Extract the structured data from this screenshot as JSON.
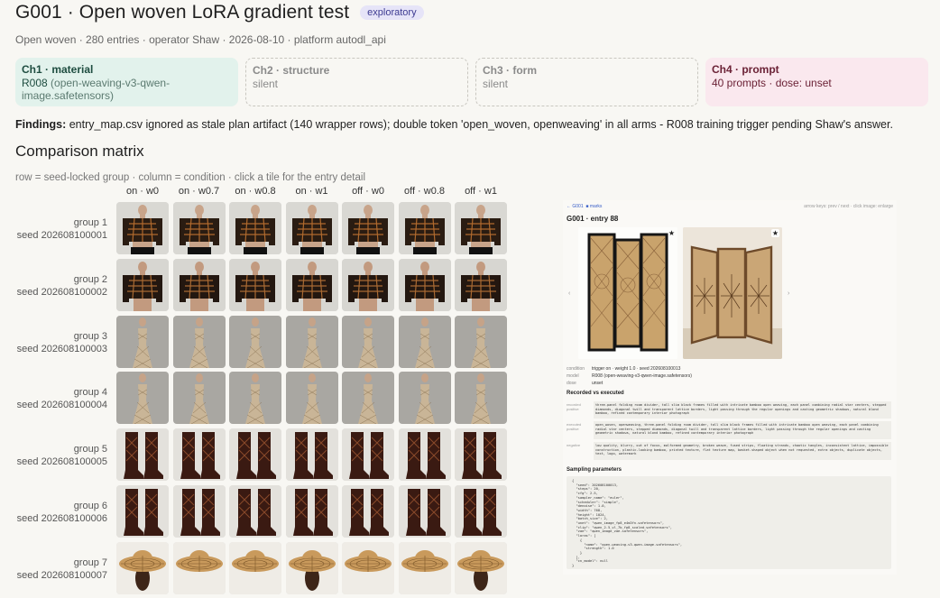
{
  "header": {
    "title": "G001 · Open woven LoRA gradient test",
    "badge": "exploratory",
    "meta": "Open woven · 280 entries · operator Shaw · 2026-08-10 · platform autodl_api"
  },
  "channels": [
    {
      "title": "Ch1 · material",
      "line1": "R008",
      "line1_rest": " (open-weaving-v3-qwen-",
      "line2": "image.safetensors)",
      "state": "active"
    },
    {
      "title": "Ch2 · structure",
      "line1": "silent",
      "state": "silent"
    },
    {
      "title": "Ch3 · form",
      "line1": "silent",
      "state": "silent"
    },
    {
      "title": "Ch4 · prompt",
      "line1": "40 prompts · dose: unset",
      "state": "active"
    }
  ],
  "findings": {
    "label": "Findings:",
    "text": " entry_map.csv ignored as stale plan artifact (140 wrapper rows); double token 'open_woven, openweaving' in all arms - R008 training trigger pending Shaw's answer."
  },
  "matrix": {
    "heading": "Comparison matrix",
    "subtitle": "row = seed-locked group · column = condition · click a tile for the entry detail",
    "columns": [
      "on · w0",
      "on · w0.7",
      "on · w0.8",
      "on · w1",
      "off · w0",
      "off · w0.8",
      "off · w1"
    ],
    "rows": [
      {
        "group": "group 1",
        "seed": "seed 202608100001",
        "subject": "jacket"
      },
      {
        "group": "group 2",
        "seed": "seed 202608100002",
        "subject": "lattice-top"
      },
      {
        "group": "group 3",
        "seed": "seed 202608100003",
        "subject": "gown"
      },
      {
        "group": "group 4",
        "seed": "seed 202608100004",
        "subject": "gown"
      },
      {
        "group": "group 5",
        "seed": "seed 202608100005",
        "subject": "boots"
      },
      {
        "group": "group 6",
        "seed": "seed 202608100006",
        "subject": "boots"
      },
      {
        "group": "group 7",
        "seed": "seed 202608100007",
        "subject": "hat"
      }
    ]
  },
  "detail": {
    "back_link": "← G001",
    "mark_link": "■ marks",
    "nav_hint": "arrow keys: prev / next · click image: enlarge",
    "title": "G001 · entry 88",
    "prev": "‹",
    "next": "›",
    "star": "★",
    "condition_label": "condition",
    "condition_value": "trigger on · weight 1.0 · seed 202608100013",
    "model_label": "model",
    "model_value": "R008 (open-weaving-v3-qwen-image.safetensors)",
    "dose_label": "dose",
    "dose_value": "unset",
    "recorded_heading": "Recorded vs executed",
    "recorded_label": "recorded positive",
    "recorded_text": "three-panel folding room divider, tall slim black frames filled with intricate bamboo open weaving, each panel combining radial star centers, stepped diamonds, diagonal twill and transparent lattice borders, light passing through the regular openings and casting geometric shadows, natural blond bamboo, refined contemporary interior photograph",
    "executed_label": "executed positive",
    "executed_text": "open_woven, openweaving, three-panel folding room divider, tall slim black frames filled with intricate bamboo open weaving, each panel combining radial star centers, stepped diamonds, diagonal twill and transparent lattice borders, light passing through the regular openings and casting geometric shadows, natural blond bamboo, refined contemporary interior photograph",
    "negative_label": "negative",
    "negative_text": "low quality, blurry, out of focus, malformed geometry, broken weave, fused strips, floating strands, chaotic tangles, inconsistent lattice, impossible construction, plastic-looking bamboo, printed texture, flat texture map, basket-shaped object when not requested, extra objects, duplicate objects, text, logo, watermark",
    "sampling_heading": "Sampling parameters",
    "sampling_code": "{\n  \"seed\": 202608100013,\n  \"steps\": 20,\n  \"cfg\": 2.5,\n  \"sampler_name\": \"euler\",\n  \"scheduler\": \"simple\",\n  \"denoise\": 1.0,\n  \"width\": 768,\n  \"height\": 1024,\n  \"batch_size\": 2,\n  \"unet\": \"qwen_image_fp8_e4m3fn.safetensors\",\n  \"clip\": \"qwen_2.5_vl_7b_fp8_scaled.safetensors\",\n  \"vae\": \"qwen_image_vae.safetensors\",\n  \"loras\": [\n    {\n      \"name\": \"open-weaving-v3-qwen-image.safetensors\",\n      \"strength\": 1.0\n    }\n  ],\n  \"cn_model\": null\n}"
  },
  "colors": {
    "accent": "#3d3a91",
    "material_bg": "#e2f2ec",
    "prompt_bg": "#fae8ee",
    "tile_bg": "#dcdcd8"
  }
}
